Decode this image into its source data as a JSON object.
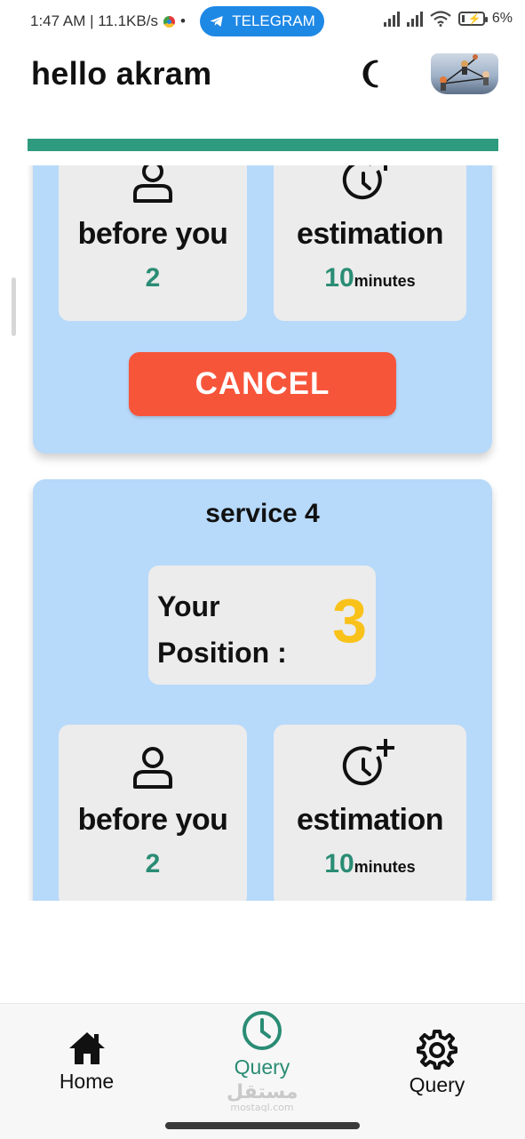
{
  "status_bar": {
    "time_speed": "1:47 AM | 11.1KB/s",
    "separator": "•",
    "notification": "TELEGRAM",
    "battery": "6%"
  },
  "header": {
    "title": "hello akram",
    "theme_icon": "moon-icon",
    "avatar": "avatar"
  },
  "colors": {
    "accent": "#2e9b7e",
    "card_background": "#b7d9fa",
    "cancel": "#f7553a",
    "position_value": "#f9c21a"
  },
  "services": [
    {
      "before_label": "before you",
      "before_value": "2",
      "estimation_label": "estimation",
      "estimation_value": "10",
      "estimation_unit": "minutes",
      "cancel_label": "CANCEL"
    },
    {
      "title": "service 4",
      "position_label": "Your Position :",
      "position_value": "3",
      "before_label": "before you",
      "before_value": "2",
      "estimation_label": "estimation",
      "estimation_value": "10",
      "estimation_unit": "minutes"
    }
  ],
  "bottom_nav": [
    {
      "label": "Home",
      "icon": "home-icon"
    },
    {
      "label": "Query",
      "icon": "clock-icon",
      "active": true
    },
    {
      "label": "Query",
      "icon": "gear-icon"
    }
  ],
  "watermark": {
    "text": "مستقل",
    "sub": "mostaql.com"
  }
}
